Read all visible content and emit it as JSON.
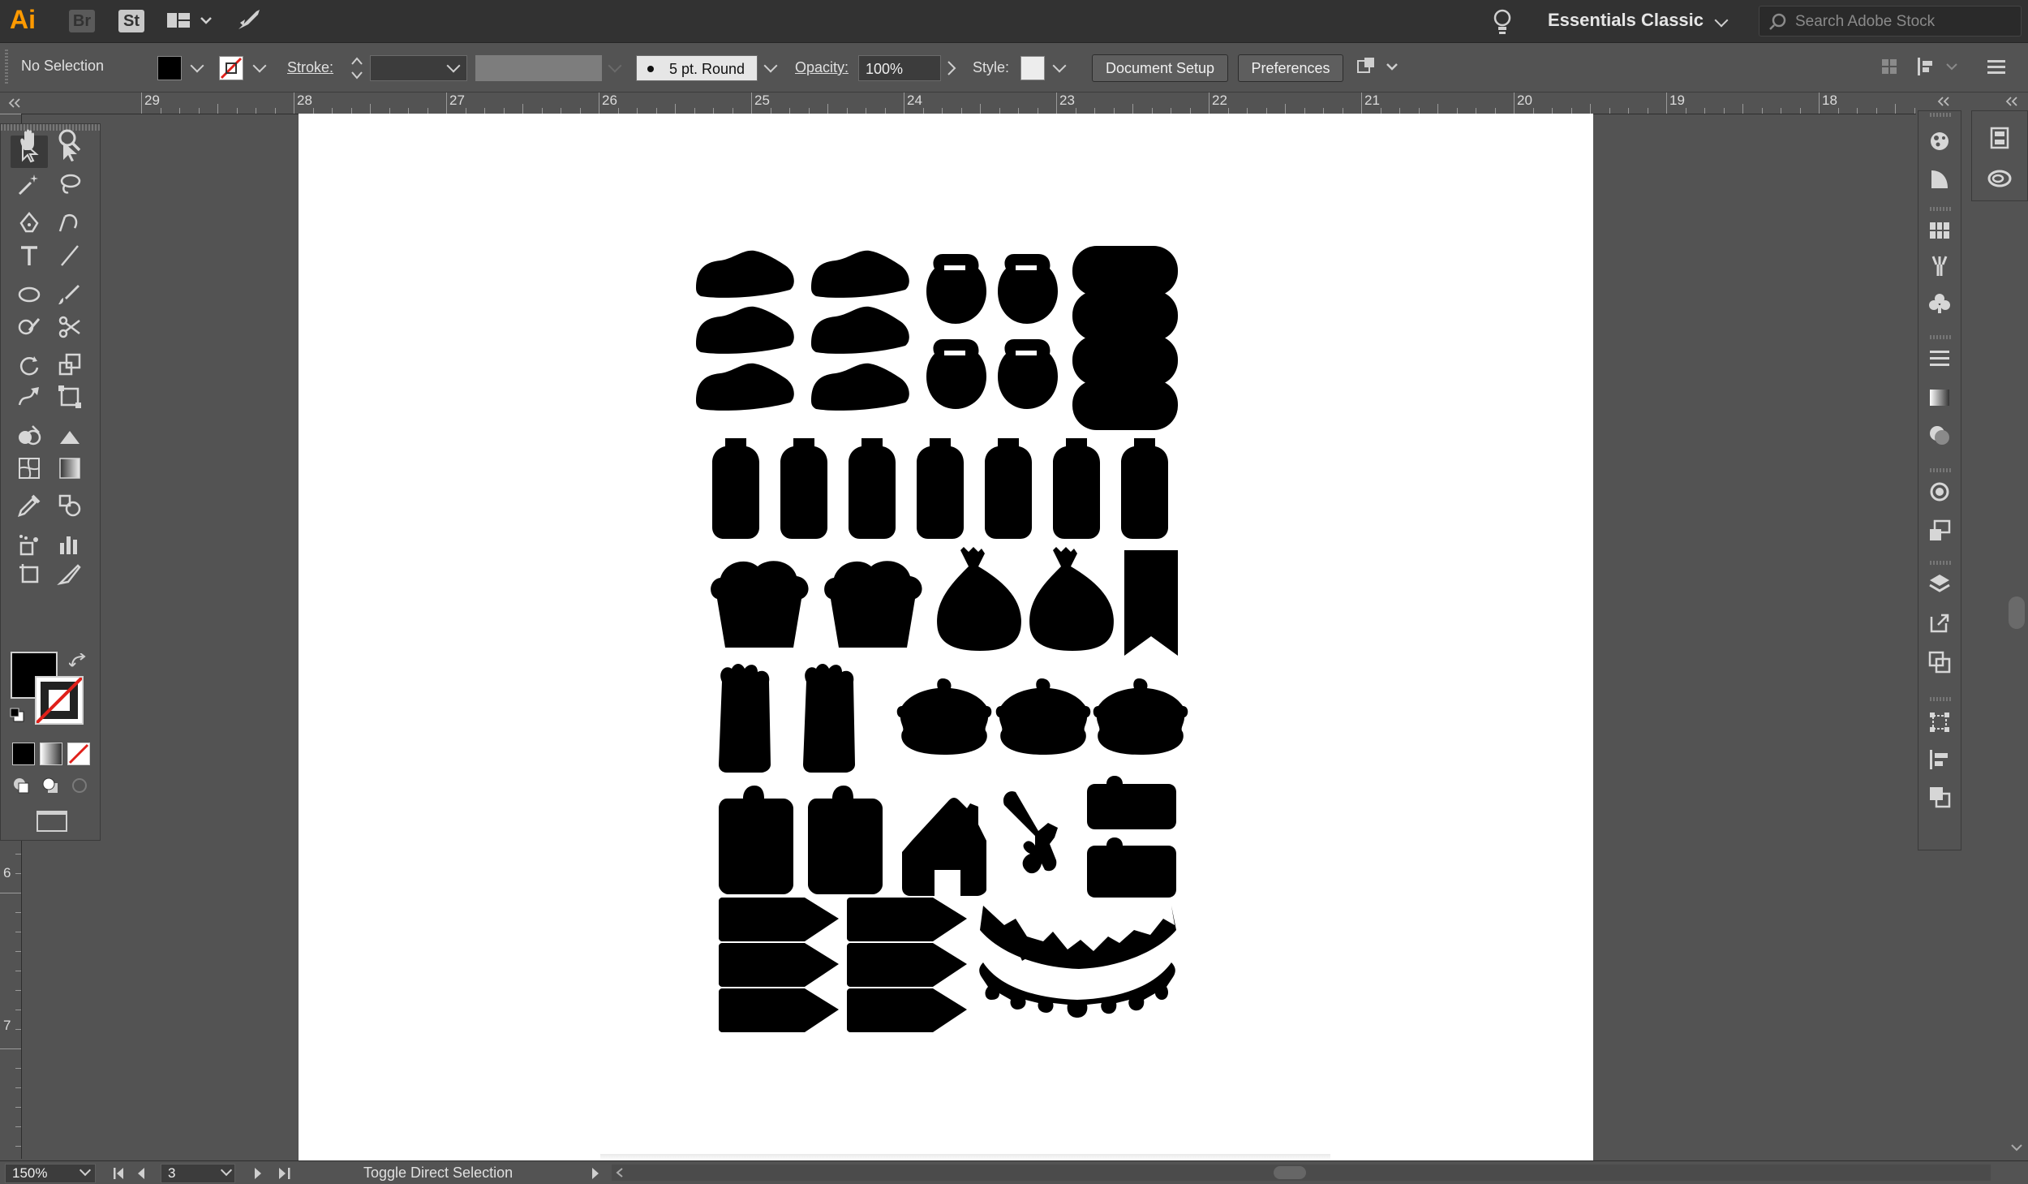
{
  "app": {
    "logo": "Ai",
    "bridge": "Br",
    "stock": "St",
    "workspace": "Essentials Classic",
    "search_placeholder": "Search Adobe Stock"
  },
  "control": {
    "selection": "No Selection",
    "stroke_label": "Stroke:",
    "brush": "5 pt. Round",
    "opacity_label": "Opacity:",
    "opacity_value": "100%",
    "style_label": "Style:",
    "document_setup": "Document Setup",
    "preferences": "Preferences"
  },
  "ruler": {
    "top_labels": [
      "29",
      "28",
      "27",
      "26",
      "25",
      "24",
      "23",
      "22",
      "21",
      "20",
      "19",
      "18"
    ],
    "left_labels": [
      "6",
      "7"
    ]
  },
  "status": {
    "zoom": "150%",
    "artboard": "3",
    "tool_hint": "Toggle Direct Selection"
  },
  "colors": {
    "fill": "#000000",
    "stroke": "none",
    "accent": "#ff9a00"
  },
  "tools": [
    "selection-tool",
    "direct-selection-tool",
    "magic-wand-tool",
    "lasso-tool",
    "pen-tool",
    "curvature-tool",
    "type-tool",
    "line-segment-tool",
    "ellipse-tool",
    "paintbrush-tool",
    "shaper-tool",
    "scissors-tool",
    "rotate-tool",
    "scale-tool",
    "warp-tool",
    "free-transform-tool",
    "shape-builder-tool",
    "perspective-grid-tool",
    "mesh-tool",
    "gradient-tool",
    "eyedropper-tool",
    "blend-tool",
    "symbol-sprayer-tool",
    "column-graph-tool",
    "artboard-tool",
    "slice-tool",
    "hand-tool",
    "zoom-tool"
  ],
  "panels": [
    "color-icon",
    "color-guide-icon",
    "swatches-icon",
    "brushes-icon",
    "symbols-icon",
    "stroke-icon",
    "gradient-icon",
    "transparency-icon",
    "appearance-icon",
    "graphic-styles-icon",
    "layers-icon",
    "asset-export-icon",
    "artboards-icon",
    "transform-icon",
    "align-icon",
    "pathfinder-icon"
  ],
  "panels_col2": [
    "libraries-icon",
    "cc-icon"
  ]
}
